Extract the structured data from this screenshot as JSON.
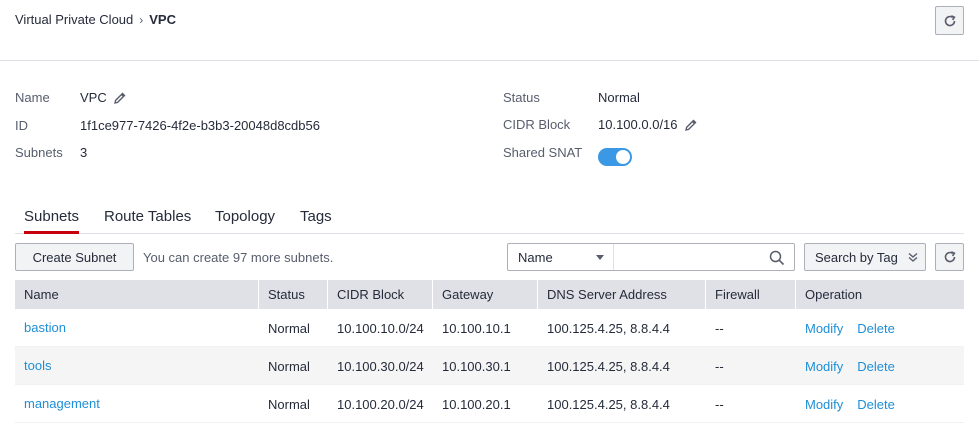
{
  "breadcrumb": {
    "parent": "Virtual Private Cloud",
    "current": "VPC"
  },
  "details": {
    "name_label": "Name",
    "name_value": "VPC",
    "id_label": "ID",
    "id_value": "1f1ce977-7426-4f2e-b3b3-20048d8cdb56",
    "subnets_label": "Subnets",
    "subnets_value": "3",
    "status_label": "Status",
    "status_value": "Normal",
    "cidr_label": "CIDR Block",
    "cidr_value": "10.100.0.0/16",
    "snat_label": "Shared SNAT",
    "snat_enabled": true
  },
  "tabs": [
    {
      "label": "Subnets",
      "active": true
    },
    {
      "label": "Route Tables",
      "active": false
    },
    {
      "label": "Topology",
      "active": false
    },
    {
      "label": "Tags",
      "active": false
    }
  ],
  "toolbar": {
    "create_label": "Create Subnet",
    "hint": "You can create 97 more subnets.",
    "search_field": "Name",
    "search_value": "",
    "tag_search_label": "Search by Tag"
  },
  "table": {
    "columns": [
      "Name",
      "Status",
      "CIDR Block",
      "Gateway",
      "DNS Server Address",
      "Firewall",
      "Operation"
    ],
    "rows": [
      {
        "name": "bastion",
        "status": "Normal",
        "cidr": "10.100.10.0/24",
        "gateway": "10.100.10.1",
        "dns": "100.125.4.25, 8.8.4.4",
        "firewall": "--",
        "modify": "Modify",
        "delete": "Delete"
      },
      {
        "name": "tools",
        "status": "Normal",
        "cidr": "10.100.30.0/24",
        "gateway": "10.100.30.1",
        "dns": "100.125.4.25, 8.8.4.4",
        "firewall": "--",
        "modify": "Modify",
        "delete": "Delete"
      },
      {
        "name": "management",
        "status": "Normal",
        "cidr": "10.100.20.0/24",
        "gateway": "10.100.20.1",
        "dns": "100.125.4.25, 8.8.4.4",
        "firewall": "--",
        "modify": "Modify",
        "delete": "Delete"
      }
    ]
  },
  "icons": {
    "refresh": "refresh-icon",
    "edit": "pencil-icon",
    "search": "search-icon",
    "caret": "caret-down-icon",
    "expand": "double-chevron-down-icon"
  },
  "colors": {
    "accent_tab": "#c7000b",
    "link": "#1e8fd6",
    "toggle_on": "#3a98e4",
    "header_bg": "#dfe1e6"
  }
}
